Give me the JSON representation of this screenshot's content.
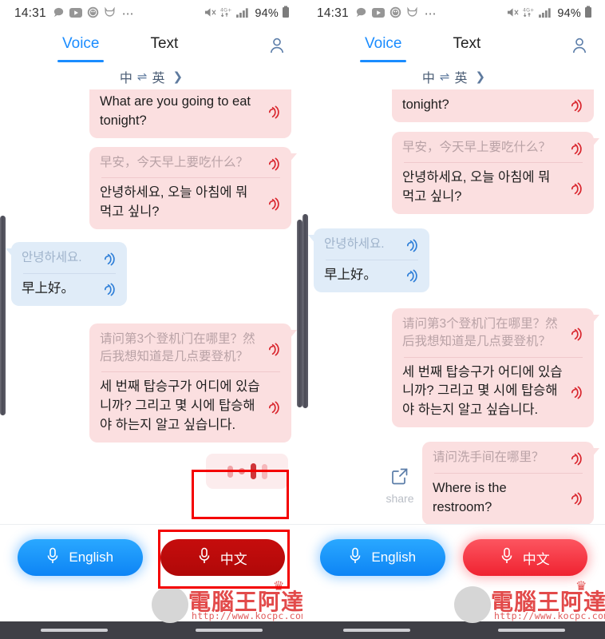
{
  "status_bar": {
    "time": "14:31",
    "left_icons": [
      "chat-bubble-icon",
      "youtube-icon",
      "starbucks-icon",
      "cat-icon",
      "more-dots-icon"
    ],
    "right_icons": [
      "mute-icon",
      "4g-plus-icon",
      "signal-bars-icon"
    ],
    "battery_percent": "94%",
    "battery_icon": "battery-icon"
  },
  "header": {
    "tabs": [
      {
        "label": "Voice",
        "active": true
      },
      {
        "label": "Text",
        "active": false
      }
    ],
    "profile_icon": "person-icon",
    "language_from": "中",
    "language_swap": "⇌",
    "language_to": "英",
    "language_chevron": "❯"
  },
  "colors": {
    "accent_blue": "#1a8cff",
    "bubble_pink": "#fbdfe0",
    "bubble_blue": "#e0ecf8",
    "speaker_red": "#d9262e",
    "speaker_blue": "#2f7fd8",
    "highlight_red": "#f40000",
    "button_blue": "#0d84f5",
    "button_red": "#ef2230",
    "button_red_pressed": "#c60d0d"
  },
  "left_panel": {
    "messages": [
      {
        "side": "right",
        "color": "pink",
        "tail": false,
        "source": null,
        "target": "What are you going to eat tonight?",
        "speaker_icon": "speaker-wave-icon"
      },
      {
        "side": "right",
        "color": "pink",
        "tail": true,
        "source": "早安，今天早上要吃什么？",
        "target": "안녕하세요, 오늘 아침에 뭐 먹고 싶니?",
        "speaker_icon": "speaker-wave-icon"
      },
      {
        "side": "left",
        "color": "blue",
        "tail": true,
        "source": "안녕하세요.",
        "target": "早上好。",
        "speaker_icon": "speaker-wave-icon"
      },
      {
        "side": "right",
        "color": "pink",
        "tail": true,
        "source": "请问第3个登机门在哪里？然后我想知道是几点要登机？",
        "target": "세 번째 탑승구가 어디에 있습니까? 그리고 몇 시에 탑승해야 하는지 알고 싶습니다.",
        "speaker_icon": "speaker-wave-icon"
      }
    ],
    "recording_indicator": {
      "name": "recording-waveform",
      "bars": 4,
      "highlighted": true
    },
    "buttons": {
      "left": {
        "label": "English",
        "icon": "microphone-icon",
        "state": "normal"
      },
      "right": {
        "label": "中文",
        "icon": "microphone-icon",
        "state": "pressed"
      }
    },
    "highlights": [
      "recording-waveform",
      "chinese-mic-button"
    ]
  },
  "right_panel": {
    "messages": [
      {
        "side": "right",
        "color": "pink",
        "tail": false,
        "source": null,
        "target": "tonight?",
        "speaker_icon": "speaker-wave-icon"
      },
      {
        "side": "right",
        "color": "pink",
        "tail": true,
        "source": "早安，今天早上要吃什么？",
        "target": "안녕하세요, 오늘 아침에 뭐 먹고 싶니?",
        "speaker_icon": "speaker-wave-icon"
      },
      {
        "side": "left",
        "color": "blue",
        "tail": true,
        "source": "안녕하세요.",
        "target": "早上好。",
        "speaker_icon": "speaker-wave-icon"
      },
      {
        "side": "right",
        "color": "pink",
        "tail": true,
        "source": "请问第3个登机门在哪里？然后我想知道是几点要登机？",
        "target": "세 번째 탑승구가 어디에 있습니까? 그리고 몇 시에 탑승해야 하는지 알고 싶습니다.",
        "speaker_icon": "speaker-wave-icon"
      },
      {
        "side": "right",
        "color": "pink",
        "tail": true,
        "source": "请问洗手间在哪里？",
        "target": "Where is the restroom?",
        "speaker_icon": "speaker-wave-icon",
        "share": {
          "label": "share",
          "icon": "share-external-link-icon"
        }
      }
    ],
    "buttons": {
      "left": {
        "label": "English",
        "icon": "microphone-icon",
        "state": "normal"
      },
      "right": {
        "label": "中文",
        "icon": "microphone-icon",
        "state": "normal"
      }
    }
  },
  "watermark": {
    "text": "電腦王阿達",
    "url": "http://www.kocpc.com.tw"
  }
}
